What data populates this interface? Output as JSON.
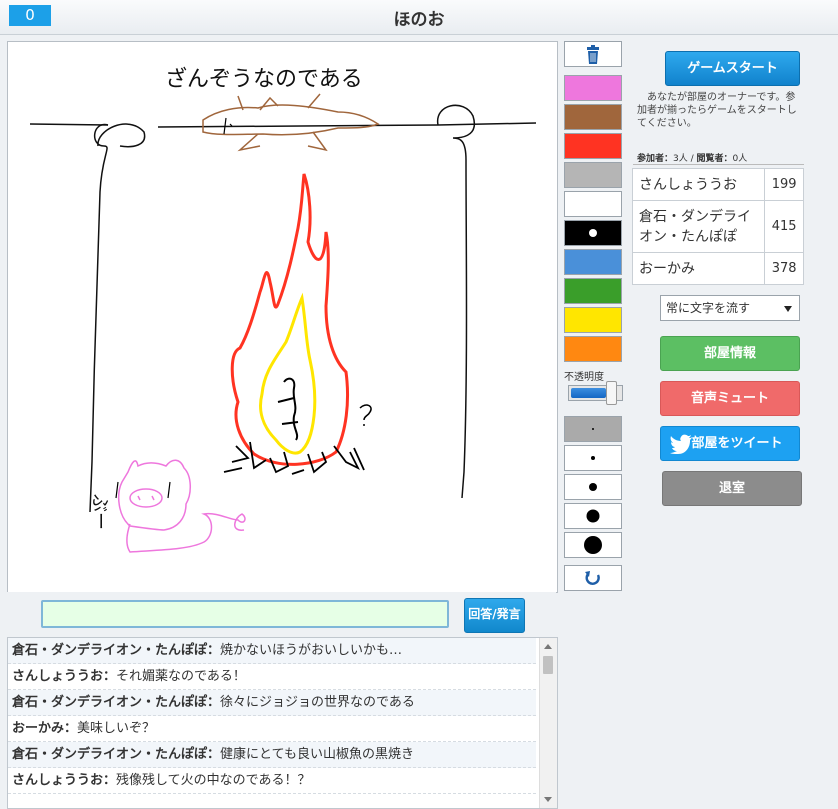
{
  "header": {
    "counter": "0",
    "room_title": "ほのお"
  },
  "canvas": {
    "drawn_text_title": "ざんぞうなのである",
    "drawn_text_pig": "ぶー"
  },
  "answer": {
    "input_value": "",
    "button_label": "回答/発言"
  },
  "chat": {
    "separator": "：",
    "lines": [
      {
        "name": "倉石・ダンデライオン・たんぽぽ",
        "text": "焼かないほうがおいしいかも…"
      },
      {
        "name": "さんしょううお",
        "text": "それ媚薬なのである！"
      },
      {
        "name": "倉石・ダンデライオン・たんぽぽ",
        "text": "徐々にジョジョの世界なのである"
      },
      {
        "name": "おーかみ",
        "text": "美味しいぞ？"
      },
      {
        "name": "倉石・ダンデライオン・たんぽぽ",
        "text": "健康にとても良い山椒魚の黒焼き"
      },
      {
        "name": "さんしょううお",
        "text": "残像残して火の中なのである！？"
      }
    ]
  },
  "tools": {
    "trash_icon": "trash-icon",
    "colors": [
      "#ee77dd",
      "#a0663c",
      "#ff3322",
      "#b5b5b5",
      "#ffffff",
      "#000000",
      "#4a90d9",
      "#3a9e2a",
      "#ffe600",
      "#ff8811"
    ],
    "opacity_label": "不透明度",
    "opacity_value": 0.88,
    "undo_icon": "undo-icon"
  },
  "right": {
    "start_button": "ゲームスタート",
    "owner_note": "あなたが部屋のオーナーです。参加者が揃ったらゲームをスタートしてください。",
    "participants_label": "参加者：",
    "participants_count": "3人",
    "viewers_sep": " / ",
    "viewers_label": "閲覧者：",
    "viewers_count": "0人",
    "players": [
      {
        "name": "さんしょううお",
        "score": "199"
      },
      {
        "name": "倉石・ダンデライオン・たんぽぽ",
        "score": "415"
      },
      {
        "name": "おーかみ",
        "score": "378"
      }
    ],
    "text_mode_select": "常に文字を流す",
    "room_info_button": "部屋情報",
    "mute_button": "音声ミュート",
    "tweet_button": "部屋をツイート",
    "leave_button": "退室"
  }
}
